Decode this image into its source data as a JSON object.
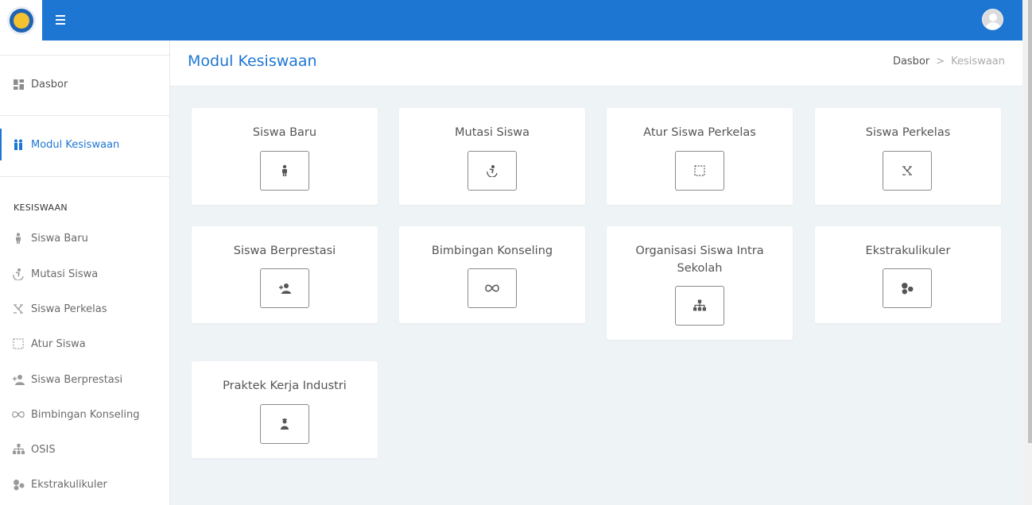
{
  "topbar": {
    "menu_icon": "hamburger-icon",
    "avatar_icon": "user-avatar-icon",
    "logo": "tut-wuri-handayani-logo"
  },
  "sidebar": {
    "main_items": [
      {
        "label": "Dasbor",
        "icon": "dashboard-icon"
      },
      {
        "label": "Modul Kesiswaan",
        "icon": "students-icon",
        "active": true
      }
    ],
    "section_header": "KESISWAAN",
    "items": [
      {
        "label": "Siswa Baru",
        "icon": "student-icon"
      },
      {
        "label": "Mutasi Siswa",
        "icon": "transfer-icon"
      },
      {
        "label": "Siswa Perkelas",
        "icon": "class-icon"
      },
      {
        "label": "Atur Siswa",
        "icon": "select-icon"
      },
      {
        "label": "Siswa Berprestasi",
        "icon": "user-plus-icon"
      },
      {
        "label": "Bimbingan Konseling",
        "icon": "infinity-icon"
      },
      {
        "label": "OSIS",
        "icon": "org-chart-icon"
      },
      {
        "label": "Ekstrakulikuler",
        "icon": "group-icon"
      }
    ]
  },
  "page": {
    "title": "Modul Kesiswaan",
    "breadcrumb": {
      "home": "Dasbor",
      "separator": ">",
      "current": "Kesiswaan"
    }
  },
  "cards": [
    {
      "title": "Siswa Baru",
      "icon": "student-icon"
    },
    {
      "title": "Mutasi Siswa",
      "icon": "transfer-icon"
    },
    {
      "title": "Atur Siswa Perkelas",
      "icon": "select-icon"
    },
    {
      "title": "Siswa Perkelas",
      "icon": "class-icon"
    },
    {
      "title": "Siswa Berprestasi",
      "icon": "user-plus-icon"
    },
    {
      "title": "Bimbingan Konseling",
      "icon": "infinity-icon"
    },
    {
      "title": "Organisasi Siswa Intra Sekolah",
      "icon": "org-chart-icon"
    },
    {
      "title": "Ekstrakulikuler",
      "icon": "group-icon"
    },
    {
      "title": "Praktek Kerja Industri",
      "icon": "worker-icon"
    }
  ],
  "colors": {
    "primary": "#1e76d3",
    "background": "#eef3f6"
  }
}
